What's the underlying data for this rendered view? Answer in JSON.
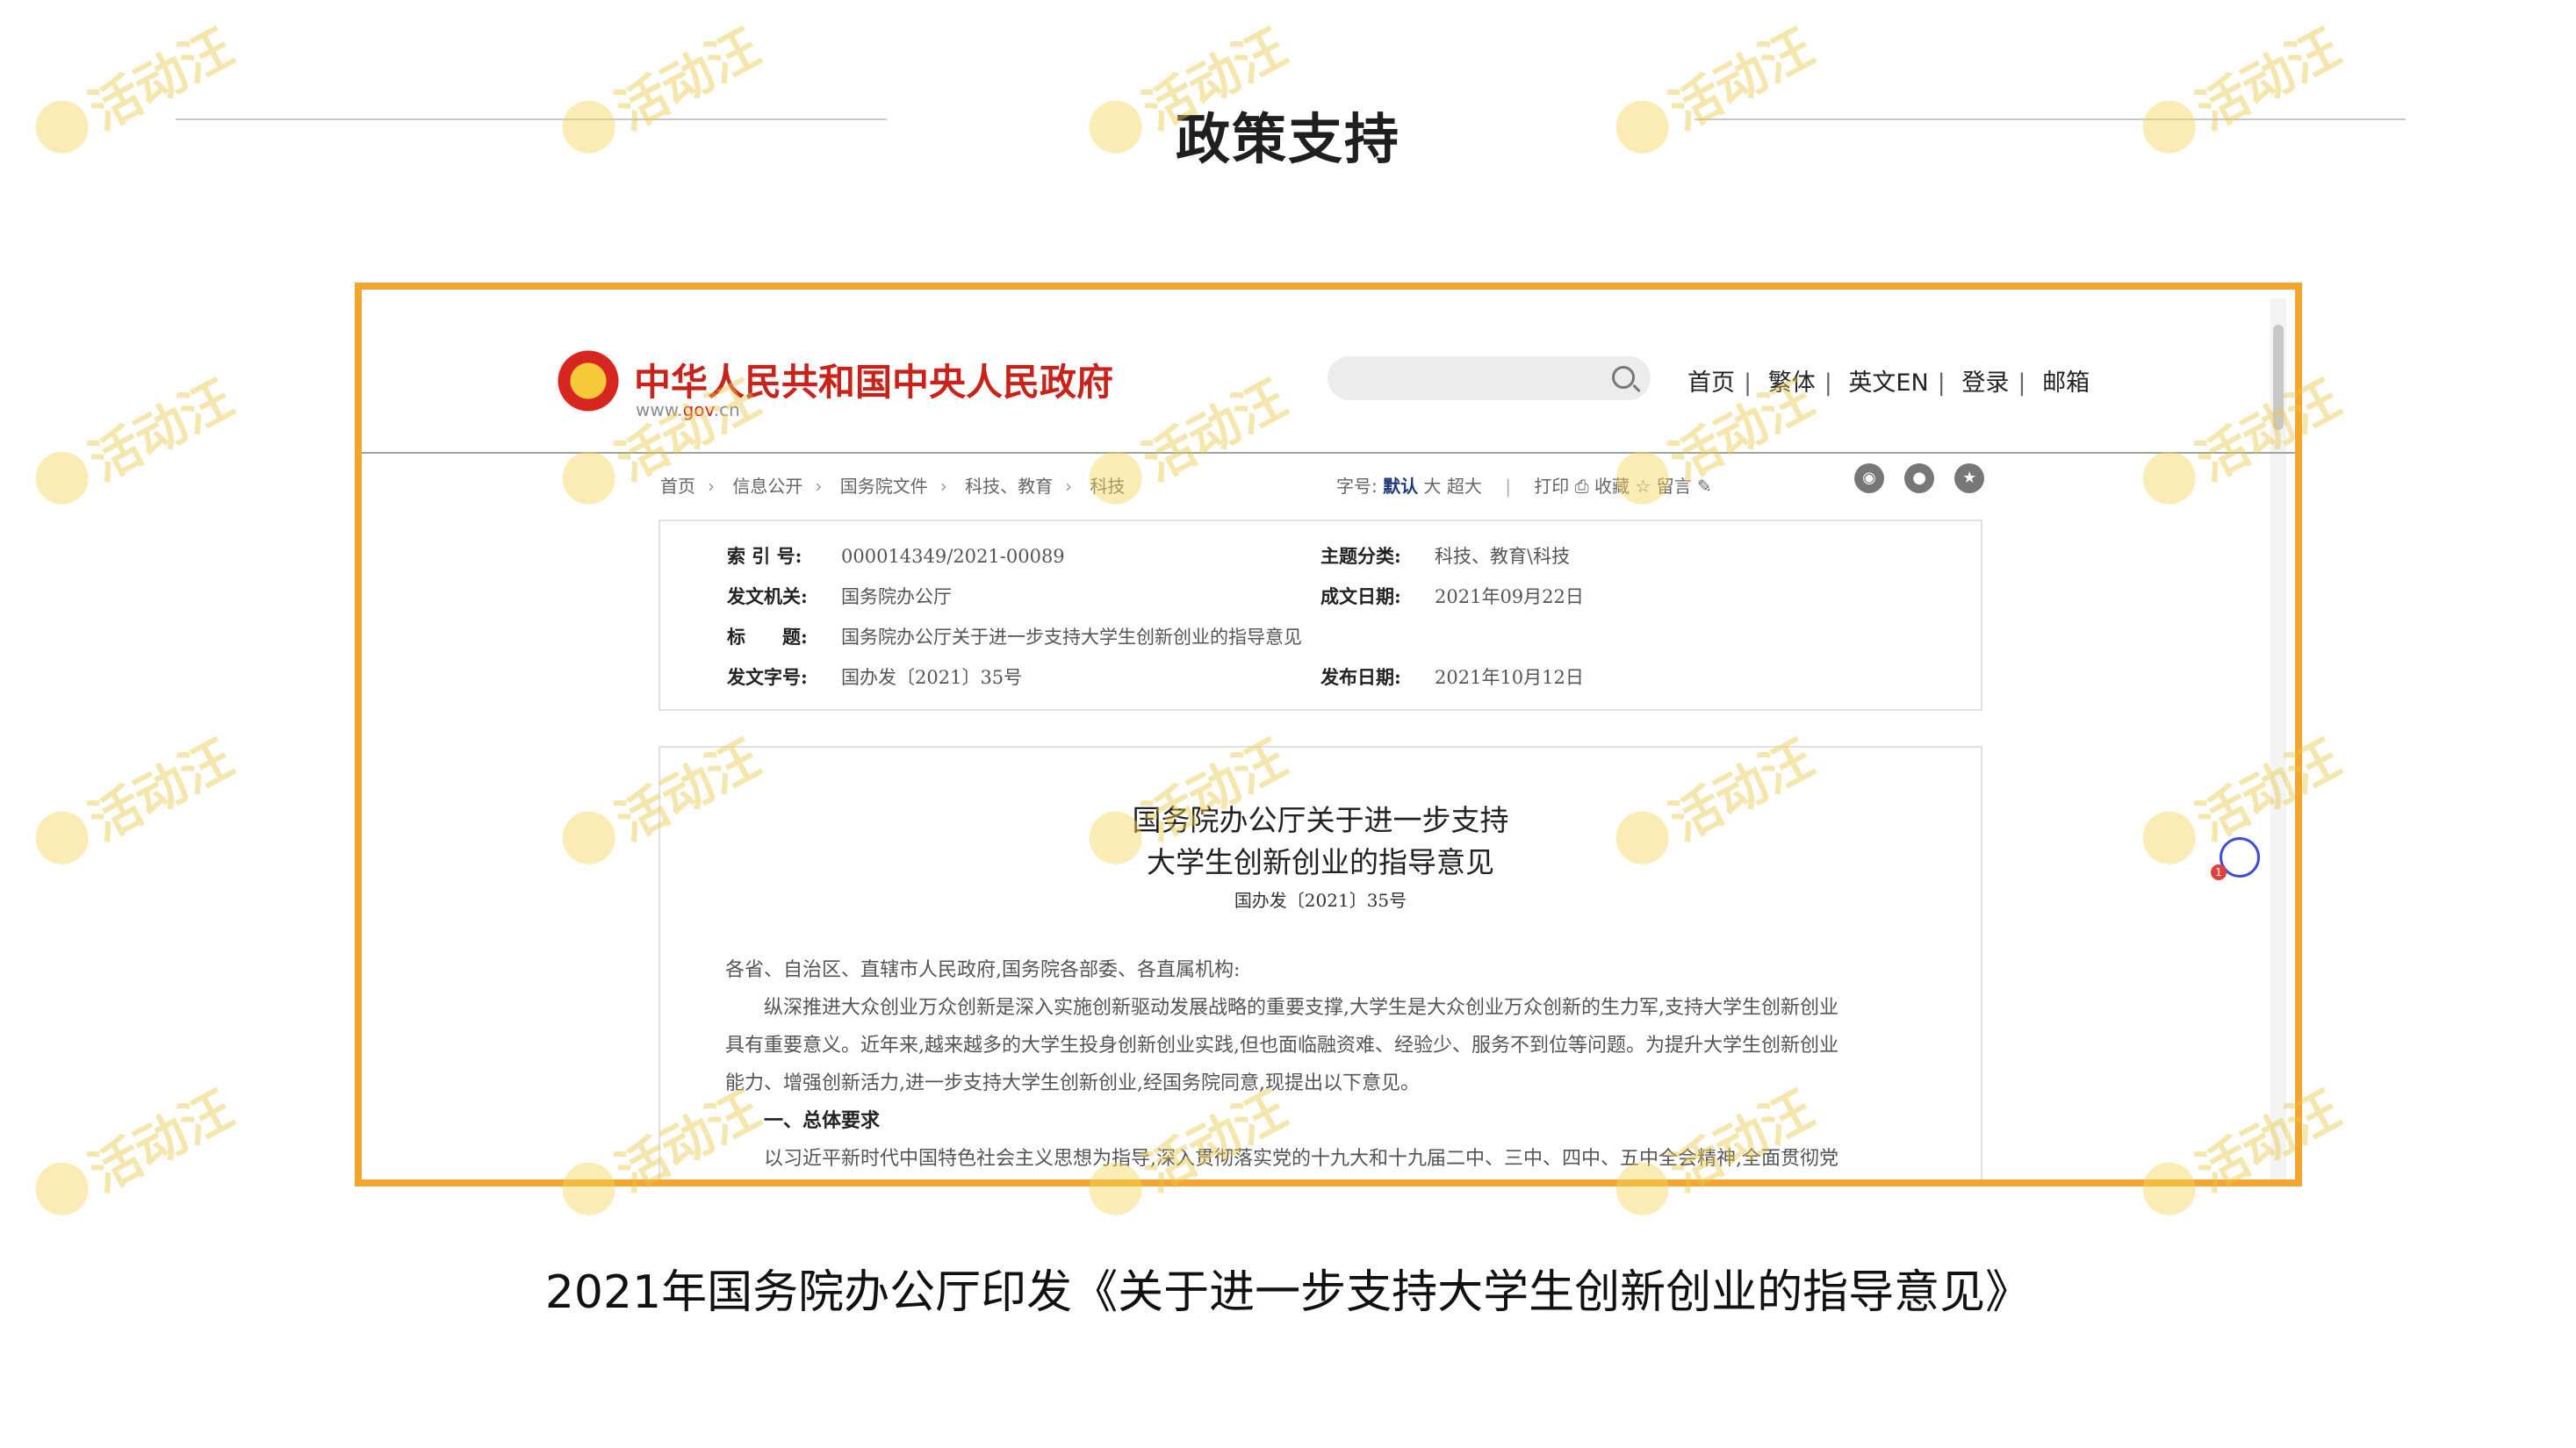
{
  "slide": {
    "title": "政策支持",
    "caption": "2021年国务院办公厅印发《关于进一步支持大学生创新创业的指导意见》"
  },
  "watermark": {
    "text": "活动汪",
    "color": "#e8c84a"
  },
  "frame_color": "#f2a52f",
  "site": {
    "name": "中华人民共和国中央人民政府",
    "url_prefix": "www.",
    "url_domain": "gov",
    "url_suffix": ".cn",
    "search_icon": "search-icon",
    "nav": [
      "首页",
      "繁体",
      "英文EN",
      "登录",
      "邮箱"
    ]
  },
  "breadcrumb": [
    "首页",
    "信息公开",
    "国务院文件",
    "科技、教育",
    "科技"
  ],
  "tools": {
    "font_label": "字号:",
    "font_default": "默认",
    "font_large": "大",
    "font_xlarge": "超大",
    "print": "打印",
    "favorite": "收藏",
    "comment": "留言"
  },
  "meta": {
    "index_label": "索 引 号:",
    "index_value": "000014349/2021-00089",
    "category_label": "主题分类:",
    "category_value": "科技、教育\\科技",
    "issuer_label": "发文机关:",
    "issuer_value": "国务院办公厅",
    "date_written_label": "成文日期:",
    "date_written_value": "2021年09月22日",
    "title_label": "标　　题:",
    "title_value": "国务院办公厅关于进一步支持大学生创新创业的指导意见",
    "doc_no_label": "发文字号:",
    "doc_no_value": "国办发〔2021〕35号",
    "publish_label": "发布日期:",
    "publish_value": "2021年10月12日"
  },
  "doc": {
    "title_line1": "国务院办公厅关于进一步支持",
    "title_line2": "大学生创新创业的指导意见",
    "number": "国办发〔2021〕35号",
    "salutation": "各省、自治区、直辖市人民政府,国务院各部委、各直属机构:",
    "p1_l1": "　　纵深推进大众创业万众创新是深入实施创新驱动发展战略的重要支撑,大学生是大众创业万众创新的生力军,支持大学生创新创业",
    "p1_l2": "具有重要意义。近年来,越来越多的大学生投身创新创业实践,但也面临融资难、经验少、服务不到位等问题。为提升大学生创新创业",
    "p1_l3": "能力、增强创新活力,进一步支持大学生创新创业,经国务院同意,现提出以下意见。",
    "section1": "　　一、总体要求",
    "p2": "　　以习近平新时代中国特色社会主义思想为指导,深入贯彻落实党的十九大和十九届二中、三中、四中、五中全会精神,全面贯彻党"
  }
}
